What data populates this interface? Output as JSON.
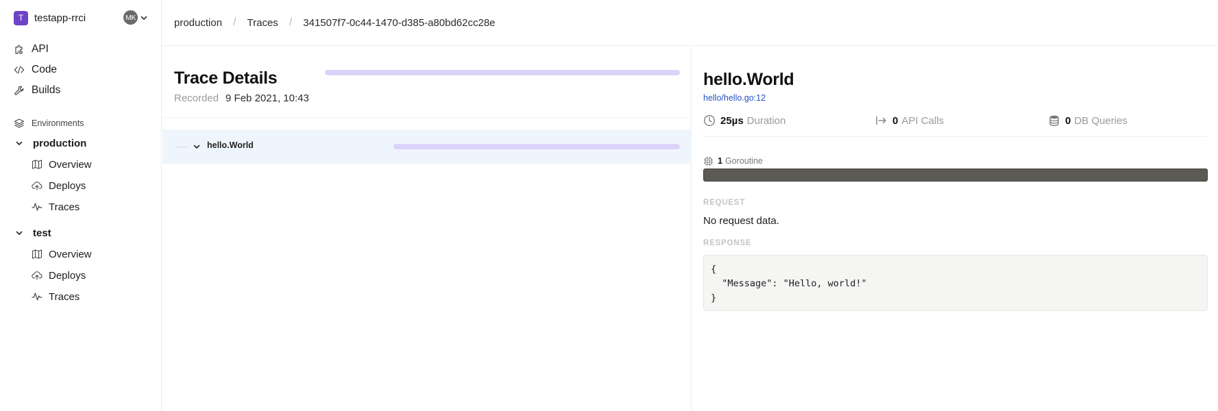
{
  "app": {
    "logo_letter": "T",
    "name": "testapp-rrci",
    "user_initials": "MK"
  },
  "nav": {
    "api": "API",
    "code": "Code",
    "builds": "Builds"
  },
  "environments": {
    "label": "Environments",
    "production": {
      "name": "production",
      "overview": "Overview",
      "deploys": "Deploys",
      "traces": "Traces"
    },
    "test": {
      "name": "test",
      "overview": "Overview",
      "deploys": "Deploys",
      "traces": "Traces"
    }
  },
  "breadcrumb": {
    "env": "production",
    "section": "Traces",
    "trace_id": "341507f7-0c44-1470-d385-a80bd62cc28e",
    "separator": "/"
  },
  "trace": {
    "title": "Trace Details",
    "recorded_label": "Recorded",
    "recorded_value": "9 Feb 2021, 10:43"
  },
  "span_row": {
    "name": "hello.World"
  },
  "details": {
    "title": "hello.World",
    "source": "hello/hello.go:12",
    "duration_value": "25µs",
    "duration_label": "Duration",
    "api_calls_value": "0",
    "api_calls_label": "API Calls",
    "db_queries_value": "0",
    "db_queries_label": "DB Queries",
    "goroutine_count": "1",
    "goroutine_label": "Goroutine",
    "request_heading": "REQUEST",
    "request_body": "No request data.",
    "response_heading": "RESPONSE",
    "response_body": "{\n  \"Message\": \"Hello, world!\"\n}"
  },
  "colors": {
    "logo": "#6d44c7",
    "timeline_bar": "#dcd3fa",
    "selected_row": "#eff5fd",
    "goroutine_bar": "#5b5a55",
    "link": "#2553c4"
  }
}
